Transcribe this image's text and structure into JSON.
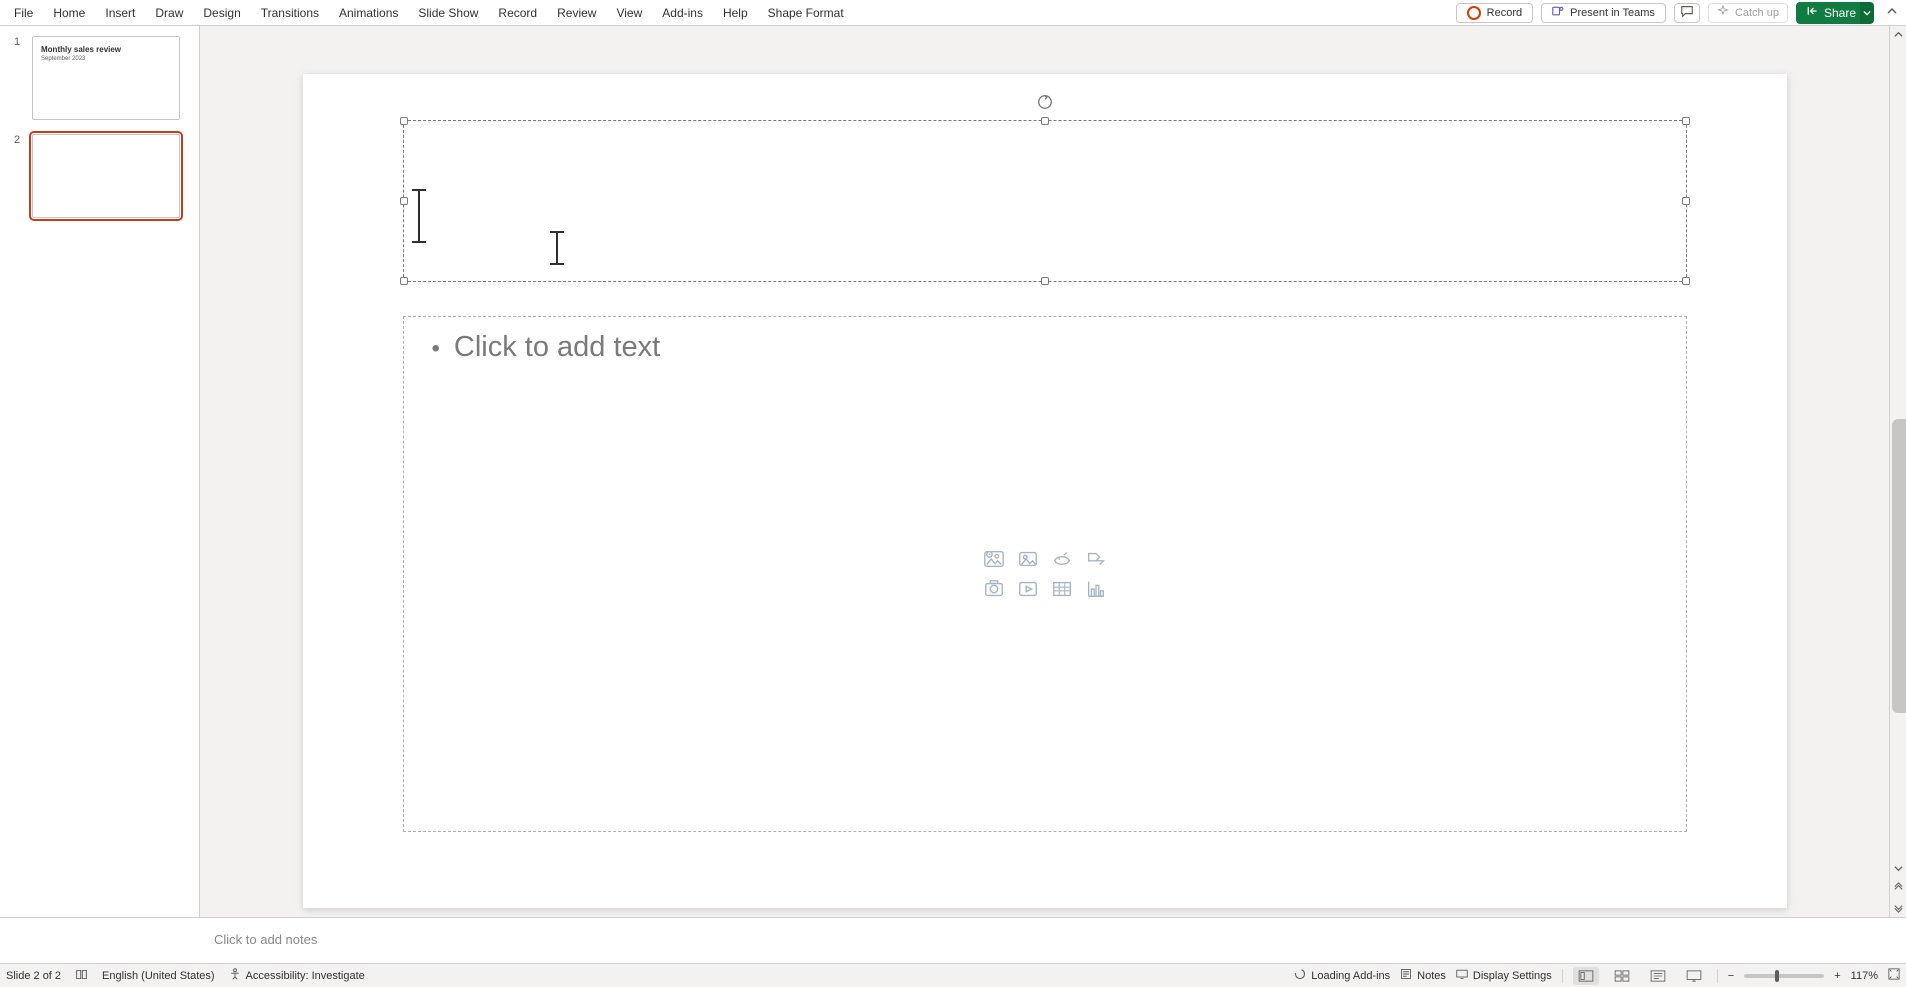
{
  "ribbon": {
    "tabs": [
      "File",
      "Home",
      "Insert",
      "Draw",
      "Design",
      "Transitions",
      "Animations",
      "Slide Show",
      "Record",
      "Review",
      "View",
      "Add-ins",
      "Help",
      "Shape Format"
    ],
    "record_label": "Record",
    "present_label": "Present in Teams",
    "catchup_label": "Catch up",
    "share_label": "Share"
  },
  "thumbnails": {
    "items": [
      {
        "num": "1",
        "title": "Monthly sales review",
        "subtitle": "September 2023",
        "selected": false
      },
      {
        "num": "2",
        "title": "",
        "subtitle": "",
        "selected": true
      }
    ]
  },
  "slide": {
    "body_placeholder": "Click to add text",
    "content_icons": [
      "stock-images",
      "pictures",
      "icons",
      "smartart",
      "cameo",
      "video",
      "table",
      "chart"
    ]
  },
  "notes": {
    "placeholder": "Click to add notes"
  },
  "status": {
    "slide_counter": "Slide 2 of 2",
    "language": "English (United States)",
    "accessibility": "Accessibility: Investigate",
    "loading": "Loading Add-ins",
    "notes_label": "Notes",
    "display_label": "Display Settings",
    "zoom_pct": "117%"
  },
  "colors": {
    "accent": "#c43e1c",
    "share_green": "#107c41"
  }
}
